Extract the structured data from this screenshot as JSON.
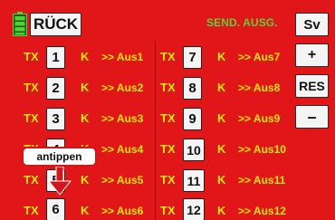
{
  "header": {
    "back_label": "RÜCK",
    "send_label": "SEND. AUSG.",
    "sv_label": "Sv"
  },
  "side_buttons": {
    "plus": "+",
    "res": "RES",
    "minus": "–"
  },
  "rows_left": [
    {
      "tx": "TX",
      "num": "1",
      "k": "K",
      "aus": ">> Aus1"
    },
    {
      "tx": "TX",
      "num": "2",
      "k": "K",
      "aus": ">> Aus2"
    },
    {
      "tx": "TX",
      "num": "3",
      "k": "K",
      "aus": ">> Aus3"
    },
    {
      "tx": "TX",
      "num": "4",
      "k": "K",
      "aus": ">> Aus4"
    },
    {
      "tx": "TX",
      "num": "5",
      "k": "K",
      "aus": ">> Aus5"
    },
    {
      "tx": "TX",
      "num": "6",
      "k": "K",
      "aus": ">> Aus6"
    }
  ],
  "rows_right": [
    {
      "tx": "TX",
      "num": "7",
      "k": "K",
      "aus": ">> Aus7"
    },
    {
      "tx": "TX",
      "num": "8",
      "k": "K",
      "aus": ">> Aus8"
    },
    {
      "tx": "TX",
      "num": "9",
      "k": "K",
      "aus": ">> Aus9"
    },
    {
      "tx": "TX",
      "num": "10",
      "k": "K",
      "aus": ">> Aus10"
    },
    {
      "tx": "TX",
      "num": "11",
      "k": "K",
      "aus": ">> Aus11"
    },
    {
      "tx": "TX",
      "num": "12",
      "k": "K",
      "aus": ">> Aus12"
    }
  ],
  "annotation": {
    "tap_label": "antippen"
  },
  "colors": {
    "background": "#e11619",
    "text": "#ffe600",
    "send_label": "#5ccf3c",
    "battery": "#4fd13a",
    "arrow": "#d4151a"
  },
  "icons": {
    "battery": "battery-icon",
    "arrow": "down-arrow-icon"
  }
}
